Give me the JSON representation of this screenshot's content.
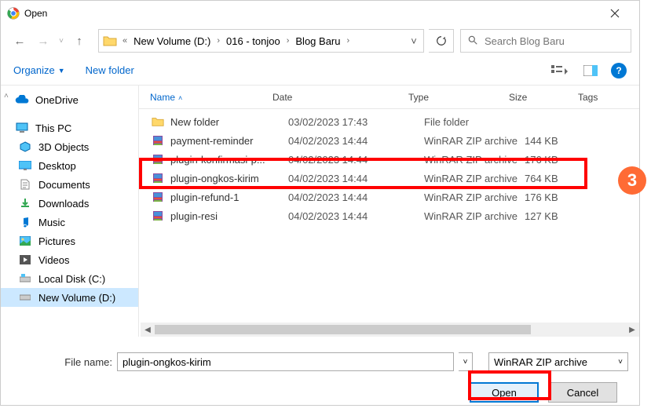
{
  "dialog": {
    "title": "Open"
  },
  "breadcrumb": {
    "root_prefix": "«",
    "items": [
      "New Volume (D:)",
      "016 - tonjoo",
      "Blog Baru"
    ]
  },
  "search": {
    "placeholder": "Search Blog Baru"
  },
  "toolbar": {
    "organize": "Organize",
    "new_folder": "New folder"
  },
  "columns": {
    "name": "Name",
    "date": "Date",
    "type": "Type",
    "size": "Size",
    "tags": "Tags"
  },
  "nav_pane": {
    "onedrive": "OneDrive",
    "this_pc": "This PC",
    "items": [
      "3D Objects",
      "Desktop",
      "Documents",
      "Downloads",
      "Music",
      "Pictures",
      "Videos",
      "Local Disk (C:)",
      "New Volume (D:)"
    ]
  },
  "files": [
    {
      "name": "New folder",
      "date": "03/02/2023 17:43",
      "type": "File folder",
      "size": "",
      "kind": "folder"
    },
    {
      "name": "payment-reminder",
      "date": "04/02/2023 14:44",
      "type": "WinRAR ZIP archive",
      "size": "144 KB",
      "kind": "zip"
    },
    {
      "name": "plugin-konfirmasi-p...",
      "date": "04/02/2023 14:44",
      "type": "WinRAR ZIP archive",
      "size": "176 KB",
      "kind": "zip"
    },
    {
      "name": "plugin-ongkos-kirim",
      "date": "04/02/2023 14:44",
      "type": "WinRAR ZIP archive",
      "size": "764 KB",
      "kind": "zip"
    },
    {
      "name": "plugin-refund-1",
      "date": "04/02/2023 14:44",
      "type": "WinRAR ZIP archive",
      "size": "176 KB",
      "kind": "zip"
    },
    {
      "name": "plugin-resi",
      "date": "04/02/2023 14:44",
      "type": "WinRAR ZIP archive",
      "size": "127 KB",
      "kind": "zip"
    }
  ],
  "filename": {
    "label": "File name:",
    "value": "plugin-ongkos-kirim",
    "filter": "WinRAR ZIP archive"
  },
  "buttons": {
    "open": "Open",
    "cancel": "Cancel"
  },
  "step_badge": "3"
}
